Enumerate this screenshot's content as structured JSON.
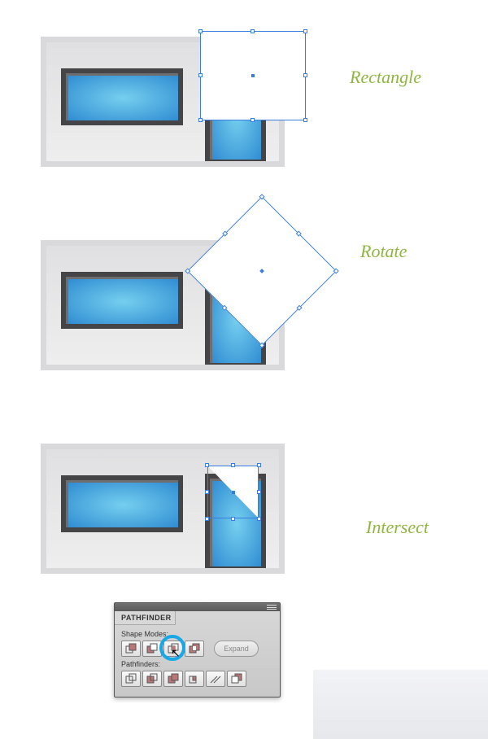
{
  "labels": {
    "step1": "Rectangle",
    "step2": "Rotate",
    "step3": "Intersect"
  },
  "pathfinder": {
    "title": "PATHFINDER",
    "shape_modes_label": "Shape Modes:",
    "expand_label": "Expand",
    "pathfinders_label": "Pathfinders:"
  }
}
